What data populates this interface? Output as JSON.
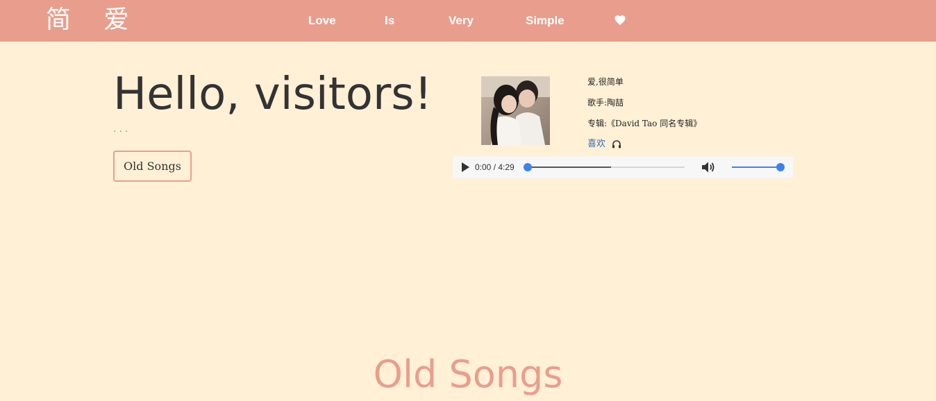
{
  "navbar": {
    "brand": "简 爱",
    "links": [
      "Love",
      "Is",
      "Very",
      "Simple"
    ],
    "heart_icon": "heart-icon",
    "background": "#e99e8d"
  },
  "hero": {
    "greeting": "Hello, visitors!",
    "dots": "...",
    "button_label": "Old Songs"
  },
  "song": {
    "title": "爱,很简单",
    "singer": "歌手:陶喆",
    "album": "专辑:《David Tao 同名专辑》",
    "like_label": "喜欢",
    "listen_icon": "headphones-icon"
  },
  "player": {
    "time": "0:00 / 4:29",
    "progress": 0,
    "buffered": 0.53,
    "volume": 1.0,
    "accent": "#3b82f0"
  },
  "section": {
    "title": "Old Songs"
  },
  "colors": {
    "page_background": "#fff0d6",
    "accent": "#e99e8d"
  }
}
